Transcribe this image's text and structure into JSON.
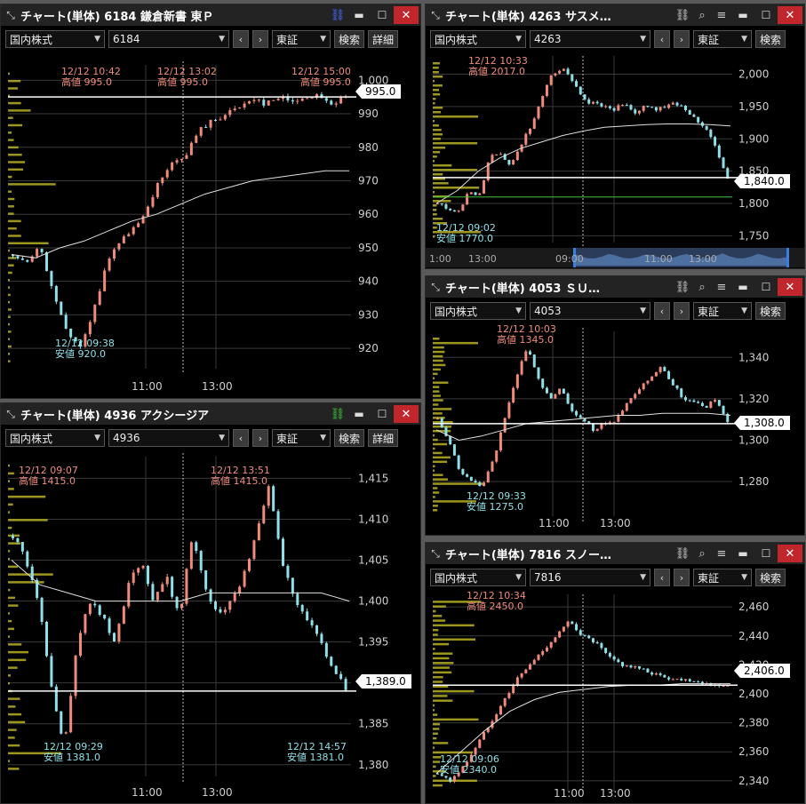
{
  "windows": [
    {
      "id": "w1",
      "title": "チャート(単体) 6184 鎌倉新書 東Ｐ",
      "link_icon": "link-icon-2",
      "market": "国内株式",
      "code": "6184",
      "exchange": "東証",
      "search_label": "検索",
      "detail_label": "詳細",
      "highs": [
        {
          "time": "12/12 10:42",
          "label": "高値 995.0"
        },
        {
          "time": "12/12 13:02",
          "label": "高値 995.0"
        },
        {
          "time": "12/12 15:00",
          "label": "高値 995.0"
        }
      ],
      "low": {
        "time": "12/12 09:38",
        "label": "安値 920.0"
      },
      "current_price": "995.0",
      "y_ticks": [
        "1,000",
        "990",
        "980",
        "970",
        "960",
        "950",
        "940",
        "930",
        "920"
      ],
      "x_ticks": [
        "11:00",
        "13:00"
      ]
    },
    {
      "id": "w2",
      "title": "チャート(単体) 4263 サスメ…",
      "link_icon": "link-icon",
      "market": "国内株式",
      "code": "4263",
      "exchange": "東証",
      "search_label": "検索",
      "highs": [
        {
          "time": "12/12 10:33",
          "label": "高値 2017.0"
        }
      ],
      "low": {
        "time": "12/12 09:02",
        "label": "安値 1770.0"
      },
      "current_price": "1,840.0",
      "y_ticks": [
        "2,000",
        "1,950",
        "1,900",
        "1,850",
        "1,800",
        "1,750"
      ],
      "x_ticks": [
        "11:00",
        "13:00"
      ],
      "mini_ticks": [
        "1:00",
        "13:00",
        "09:00",
        "11:00",
        "13:00"
      ]
    },
    {
      "id": "w3",
      "title": "チャート(単体) 4053 ＳＵ…",
      "link_icon": "link-icon",
      "market": "国内株式",
      "code": "4053",
      "exchange": "東証",
      "search_label": "検索",
      "highs": [
        {
          "time": "12/12 10:03",
          "label": "高値 1345.0"
        }
      ],
      "low": {
        "time": "12/12 09:33",
        "label": "安値 1275.0"
      },
      "current_price": "1,308.0",
      "y_ticks": [
        "1,340",
        "1,320",
        "1,300",
        "1,280"
      ],
      "x_ticks": [
        "11:00",
        "13:00"
      ]
    },
    {
      "id": "w4",
      "title": "チャート(単体) 4936 アクシージア",
      "link_icon": "link-icon-3",
      "market": "国内株式",
      "code": "4936",
      "exchange": "東証",
      "search_label": "検索",
      "detail_label": "詳細",
      "highs": [
        {
          "time": "12/12 09:07",
          "label": "高値 1415.0"
        },
        {
          "time": "12/12 13:51",
          "label": "高値 1415.0"
        }
      ],
      "lows": [
        {
          "time": "12/12 09:29",
          "label": "安値 1381.0"
        },
        {
          "time": "12/12 14:57",
          "label": "安値 1381.0"
        }
      ],
      "current_price": "1,389.0",
      "y_ticks": [
        "1,415",
        "1,410",
        "1,405",
        "1,400",
        "1,395",
        "1,390",
        "1,385",
        "1,380"
      ],
      "x_ticks": [
        "11:00",
        "13:00"
      ]
    },
    {
      "id": "w5",
      "title": "チャート(単体) 7816 スノー…",
      "link_icon": "link-icon",
      "market": "国内株式",
      "code": "7816",
      "exchange": "東証",
      "search_label": "検索",
      "highs": [
        {
          "time": "12/12 10:34",
          "label": "高値 2450.0"
        }
      ],
      "low": {
        "time": "12/12 09:06",
        "label": "安値 2340.0"
      },
      "current_price": "2,406.0",
      "y_ticks": [
        "2,460",
        "2,440",
        "2,420",
        "2,400",
        "2,380",
        "2,360",
        "2,340"
      ],
      "x_ticks": [
        "11:00",
        "13:00"
      ]
    }
  ],
  "colors": {
    "up": "#f08b7b",
    "down": "#8fe0e8",
    "vwap": "#e0e0e0",
    "volume_profile": "#b8b224",
    "grid": "#3a3a3a",
    "support": "#3fc43f"
  },
  "chart_data": [
    {
      "type": "candlestick",
      "window": "6184",
      "ylim": [
        915,
        1003
      ],
      "price_path": [
        948,
        945,
        950,
        938,
        925,
        920,
        930,
        945,
        952,
        955,
        960,
        970,
        975,
        978,
        985,
        988,
        990,
        992,
        995,
        993,
        995,
        994,
        995,
        995,
        993,
        995
      ],
      "vwap": [
        948,
        947,
        950,
        952,
        955,
        958,
        960,
        963,
        966,
        968,
        970,
        971,
        972,
        973,
        973
      ],
      "current": 995
    },
    {
      "type": "candlestick",
      "window": "4263",
      "ylim": [
        1745,
        2020
      ],
      "price_path": [
        1800,
        1790,
        1785,
        1820,
        1810,
        1870,
        1880,
        1860,
        1890,
        1920,
        1960,
        2000,
        2010,
        1990,
        1960,
        1955,
        1950,
        1945,
        1955,
        1940,
        1950,
        1945,
        1950,
        1955,
        1945,
        1930,
        1915,
        1880,
        1840
      ],
      "vwap": [
        1800,
        1820,
        1850,
        1870,
        1885,
        1895,
        1905,
        1912,
        1918,
        1920,
        1922,
        1923,
        1923,
        1922,
        1920
      ],
      "current": 1840
    },
    {
      "type": "candlestick",
      "window": "4053",
      "ylim": [
        1265,
        1350
      ],
      "price_path": [
        1310,
        1300,
        1285,
        1280,
        1278,
        1290,
        1310,
        1330,
        1345,
        1330,
        1320,
        1325,
        1315,
        1310,
        1305,
        1308,
        1310,
        1318,
        1325,
        1330,
        1335,
        1328,
        1320,
        1318,
        1316,
        1320,
        1308
      ],
      "vwap": [
        1305,
        1300,
        1302,
        1305,
        1308,
        1309,
        1310,
        1311,
        1312,
        1312,
        1313,
        1313,
        1313,
        1312
      ],
      "current": 1308
    },
    {
      "type": "candlestick",
      "window": "4936",
      "ylim": [
        1379,
        1417
      ],
      "price_path": [
        1408,
        1405,
        1400,
        1390,
        1382,
        1395,
        1400,
        1398,
        1395,
        1402,
        1405,
        1400,
        1403,
        1398,
        1408,
        1402,
        1398,
        1400,
        1403,
        1408,
        1414,
        1405,
        1400,
        1398,
        1395,
        1392,
        1389
      ],
      "vwap": [
        1405,
        1402,
        1401,
        1400,
        1400,
        1400,
        1400,
        1401,
        1401,
        1401,
        1401,
        1401,
        1400
      ],
      "current": 1389
    },
    {
      "type": "candlestick",
      "window": "7816",
      "ylim": [
        2335,
        2465
      ],
      "price_path": [
        2345,
        2340,
        2350,
        2365,
        2380,
        2395,
        2410,
        2420,
        2430,
        2440,
        2450,
        2440,
        2435,
        2425,
        2420,
        2418,
        2415,
        2412,
        2410,
        2410,
        2408,
        2406,
        2406
      ],
      "vwap": [
        2345,
        2360,
        2375,
        2388,
        2396,
        2401,
        2403,
        2405,
        2406,
        2406,
        2407,
        2407,
        2407
      ],
      "current": 2406
    }
  ]
}
